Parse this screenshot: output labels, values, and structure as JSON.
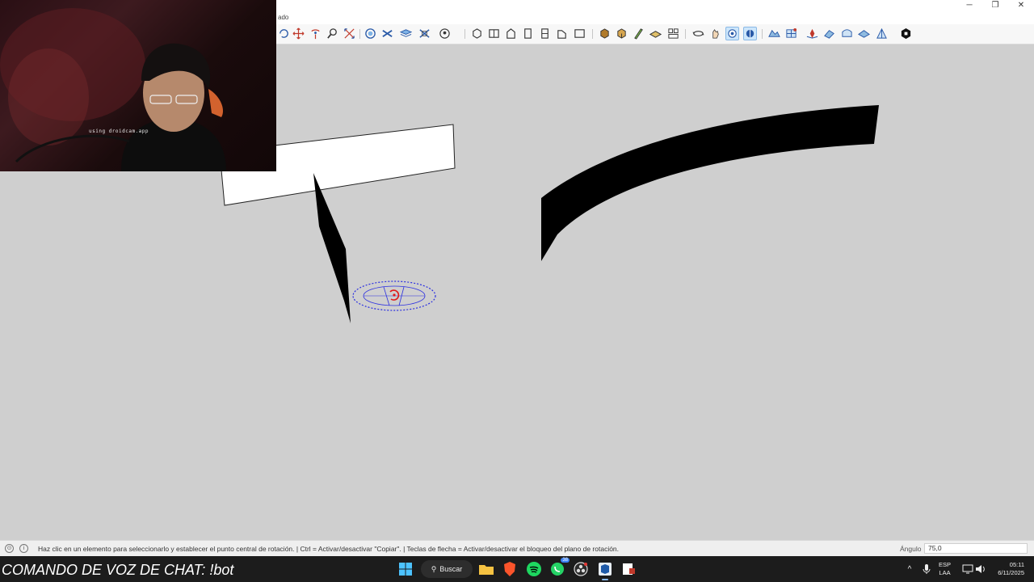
{
  "app": {
    "menu_fragment": "ado",
    "window_controls": [
      "minimize-icon",
      "restore-icon",
      "close-icon"
    ]
  },
  "toolbar": {
    "tools": [
      {
        "name": "followme",
        "icon": "followme-icon"
      },
      {
        "name": "move",
        "icon": "move-icon"
      },
      {
        "name": "rotate",
        "icon": "rotate-icon"
      },
      {
        "name": "zoom",
        "icon": "zoom-icon"
      },
      {
        "name": "zoom-extents",
        "icon": "zoom-extents-icon"
      },
      {
        "name": "section",
        "icon": "section-plane-icon"
      },
      {
        "name": "solid",
        "icon": "solid-tools-icon"
      },
      {
        "name": "layers",
        "icon": "layers-icon"
      },
      {
        "name": "components",
        "icon": "components-icon"
      },
      {
        "name": "user",
        "icon": "user-icon"
      },
      {
        "name": "iso",
        "icon": "iso-view-icon"
      },
      {
        "name": "top",
        "icon": "top-view-icon"
      },
      {
        "name": "front",
        "icon": "front-view-icon"
      },
      {
        "name": "right",
        "icon": "right-view-icon"
      },
      {
        "name": "back",
        "icon": "back-view-icon"
      },
      {
        "name": "left",
        "icon": "left-view-icon"
      },
      {
        "name": "bottom",
        "icon": "bottom-view-icon"
      },
      {
        "name": "xray",
        "icon": "xray-icon"
      },
      {
        "name": "wire",
        "icon": "wireframe-icon"
      },
      {
        "name": "hidden",
        "icon": "hidden-line-icon"
      },
      {
        "name": "shaded",
        "icon": "shaded-icon"
      },
      {
        "name": "textured",
        "icon": "textured-icon"
      },
      {
        "name": "orbit",
        "icon": "orbit-icon"
      },
      {
        "name": "pan",
        "icon": "pan-icon"
      },
      {
        "name": "walk",
        "icon": "walk-icon"
      },
      {
        "name": "lookaround",
        "icon": "look-around-icon"
      },
      {
        "name": "sandbox1",
        "icon": "sandbox-contours-icon"
      },
      {
        "name": "sandbox2",
        "icon": "sandbox-scratch-icon"
      },
      {
        "name": "sandbox3",
        "icon": "sandbox-smoove-icon"
      },
      {
        "name": "sandbox4",
        "icon": "sandbox-stamp-icon"
      },
      {
        "name": "sandbox5",
        "icon": "sandbox-drape-icon"
      },
      {
        "name": "sandbox6",
        "icon": "sandbox-detail-icon"
      },
      {
        "name": "sandbox7",
        "icon": "sandbox-flip-icon"
      },
      {
        "name": "extension",
        "icon": "extension-icon"
      }
    ]
  },
  "webcam": {
    "caption": "using droidcam.app"
  },
  "status": {
    "hint": "Haz clic en un elemento para seleccionarlo y establecer el punto central de rotación.  |  Ctrl = Activar/desactivar \"Copiar\".  |  Teclas de flecha = Activar/desactivar el bloqueo del plano de rotación.",
    "measure_label": "Ángulo",
    "measure_value": "75,0"
  },
  "taskbar": {
    "chat_command": "COMANDO DE VOZ DE CHAT: !bot",
    "search_label": "Buscar",
    "whatsapp_badge": "38",
    "lang_top": "ESP",
    "lang_bottom": "LAA",
    "time": "05:11",
    "date": "6/11/2025"
  },
  "colors": {
    "viewport_bg": "#cfcfcf",
    "rotate_gizmo": "#2a2ee0",
    "gizmo_center": "#e01b1b",
    "taskbar_bg": "#1c1c1c"
  }
}
